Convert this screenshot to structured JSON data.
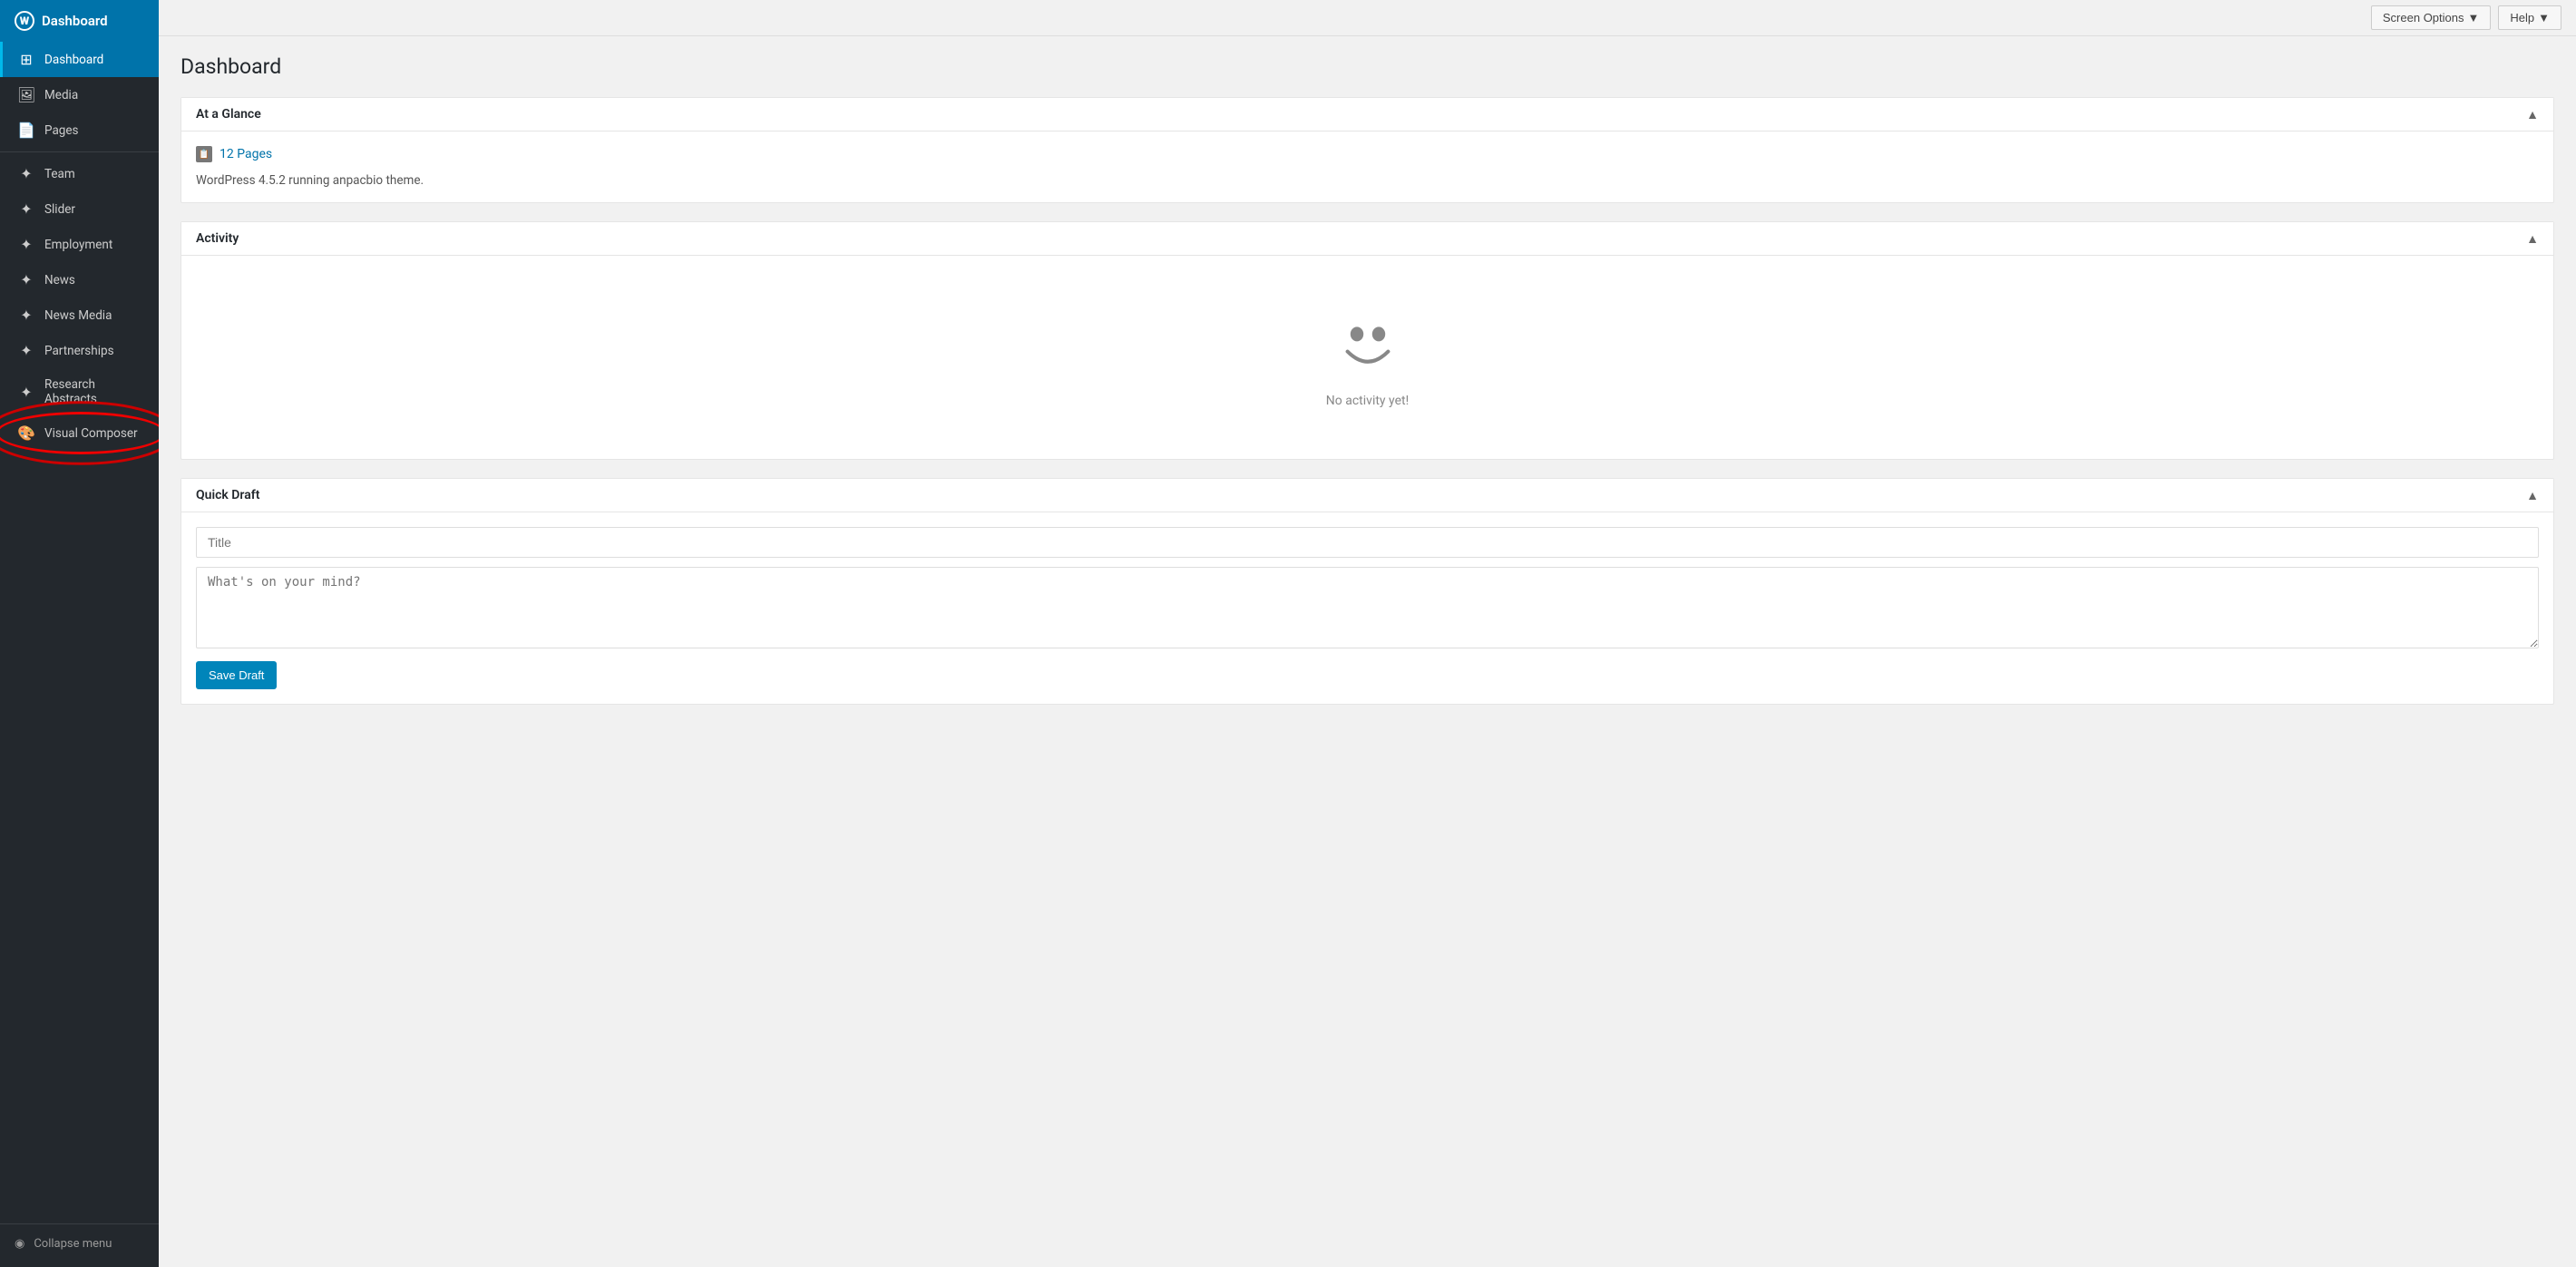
{
  "sidebar": {
    "logo": {
      "icon": "W",
      "label": "Dashboard"
    },
    "items": [
      {
        "id": "dashboard",
        "label": "Dashboard",
        "icon": "⊞",
        "active": true
      },
      {
        "id": "media",
        "label": "Media",
        "icon": "🖼"
      },
      {
        "id": "pages",
        "label": "Pages",
        "icon": "📄"
      },
      {
        "id": "team",
        "label": "Team",
        "icon": "✦"
      },
      {
        "id": "slider",
        "label": "Slider",
        "icon": "✦"
      },
      {
        "id": "employment",
        "label": "Employment",
        "icon": "✦"
      },
      {
        "id": "news",
        "label": "News",
        "icon": "✦"
      },
      {
        "id": "news-media",
        "label": "News Media",
        "icon": "✦"
      },
      {
        "id": "partnerships",
        "label": "Partnerships",
        "icon": "✦"
      },
      {
        "id": "research-abstracts",
        "label": "Research Abstracts",
        "icon": "✦"
      },
      {
        "id": "visual-composer",
        "label": "Visual Composer",
        "icon": "🎨"
      }
    ],
    "collapse_label": "Collapse menu"
  },
  "topbar": {
    "screen_options_label": "Screen Options",
    "help_label": "Help"
  },
  "page": {
    "title": "Dashboard",
    "panels": {
      "at_a_glance": {
        "header": "At a Glance",
        "pages_count": "12 Pages",
        "wp_version_text": "WordPress 4.5.2 running anpacbio theme."
      },
      "activity": {
        "header": "Activity",
        "empty_text": "No activity yet!"
      },
      "quick_draft": {
        "header": "Quick Draft",
        "title_placeholder": "Title",
        "content_placeholder": "What's on your mind?",
        "save_label": "Save Draft"
      }
    }
  }
}
